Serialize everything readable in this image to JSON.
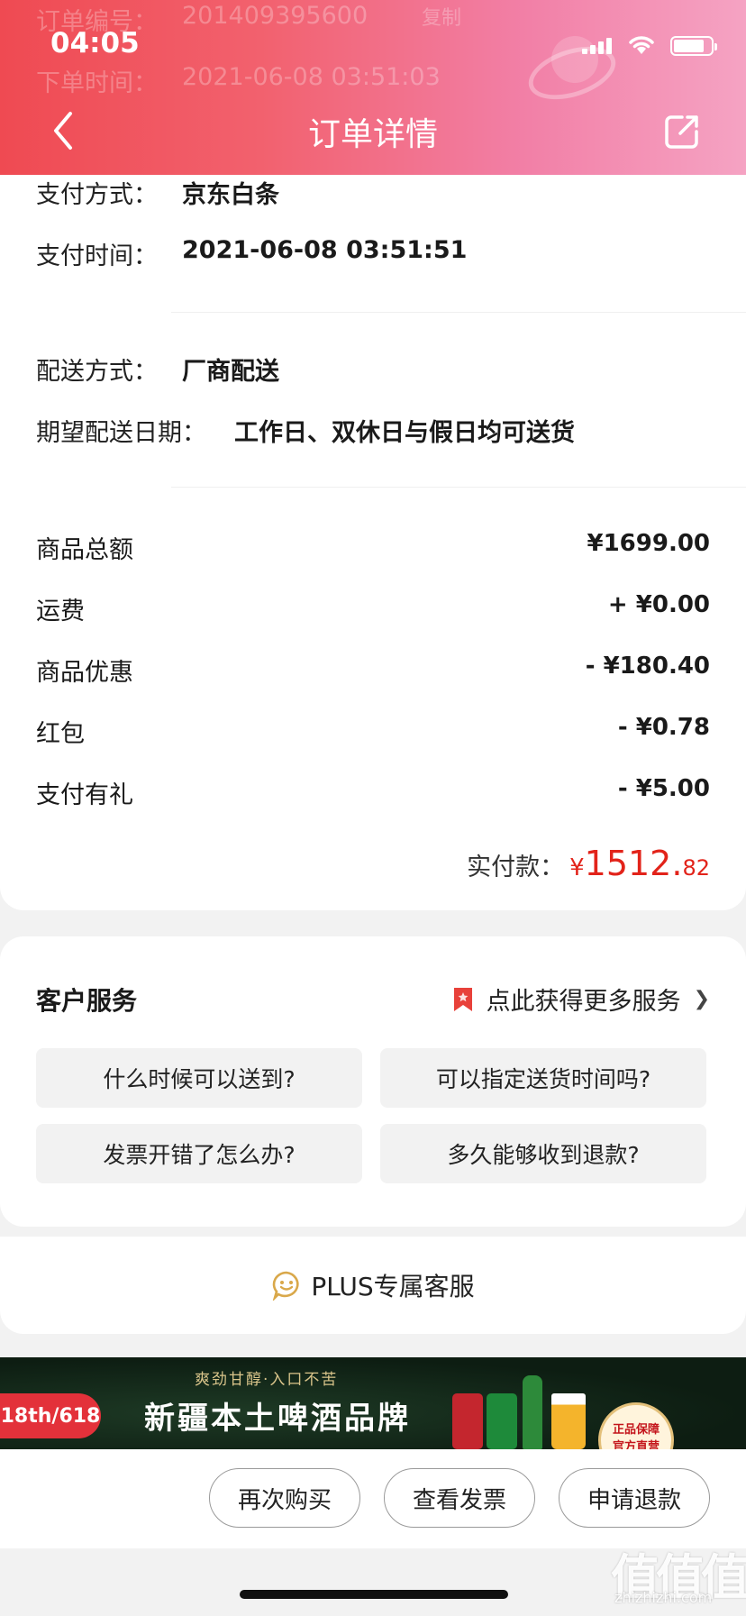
{
  "status_bar": {
    "time": "04:05"
  },
  "header": {
    "title": "订单详情",
    "ghost_order_label": "订单编号：",
    "ghost_order_number": "201409395600",
    "ghost_copy": "复制",
    "ghost_time_label": "下单时间：",
    "ghost_time_value": "2021-06-08 03:51:03"
  },
  "payment": {
    "method_label": "支付方式：",
    "method_value": "京东白条",
    "time_label": "支付时间：",
    "time_value": "2021-06-08 03:51:51"
  },
  "delivery": {
    "method_label": "配送方式：",
    "method_value": "厂商配送",
    "date_label": "期望配送日期：",
    "date_value": "工作日、双休日与假日均可送货"
  },
  "amounts": [
    {
      "label": "商品总额",
      "value": "¥1699.00"
    },
    {
      "label": "运费",
      "value": "+ ¥0.00"
    },
    {
      "label": "商品优惠",
      "value": "- ¥180.40"
    },
    {
      "label": "红包",
      "value": "- ¥0.78"
    },
    {
      "label": "支付有礼",
      "value": "- ¥5.00"
    }
  ],
  "total": {
    "label": "实付款：",
    "currency": "¥",
    "integer": "1512.",
    "decimal": "82",
    "color": "#e2231a"
  },
  "service": {
    "title": "客户服务",
    "more_label": "点此获得更多服务",
    "faqs": [
      "什么时候可以送到?",
      "可以指定送货时间吗?",
      "发票开错了怎么办?",
      "多久能够收到退款?"
    ]
  },
  "plus_service": {
    "label": "PLUS专属客服"
  },
  "banner": {
    "tag": "18th/618",
    "subtitle": "爽劲甘醇·入口不苦",
    "title": "新疆本土啤酒品牌",
    "badge_line1": "正品保障",
    "badge_line2": "官方直营"
  },
  "actions": {
    "rebuy": "再次购买",
    "invoice": "查看发票",
    "refund": "申请退款"
  },
  "watermark": {
    "main": "值值值",
    "sub": "zhizhizhi.com"
  },
  "colors": {
    "header_start": "#ef4a52",
    "header_end": "#f5a3c3",
    "accent": "#e2231a",
    "bookmark": "#e8413a"
  }
}
